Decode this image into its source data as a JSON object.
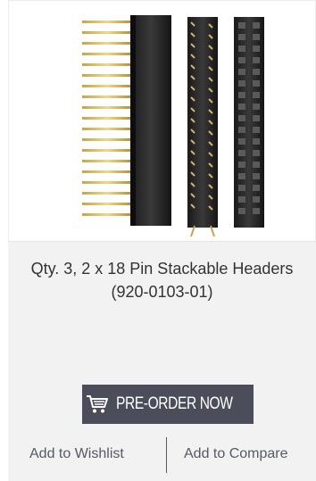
{
  "product": {
    "title": "Qty. 3, 2 x 18 Pin Stackable Headers (920-0103-01)",
    "image_alt": "2 x 18 pin stackable headers"
  },
  "actions": {
    "preorder_label": "PRE-ORDER NOW",
    "wishlist_label": "Add to Wishlist",
    "compare_label": "Add to Compare"
  },
  "icons": {
    "cart": "shopping-cart-icon"
  },
  "colors": {
    "button_bg": "#4b4e5a",
    "info_bg": "#f2f2f2",
    "link": "#555a63",
    "title": "#333333"
  }
}
